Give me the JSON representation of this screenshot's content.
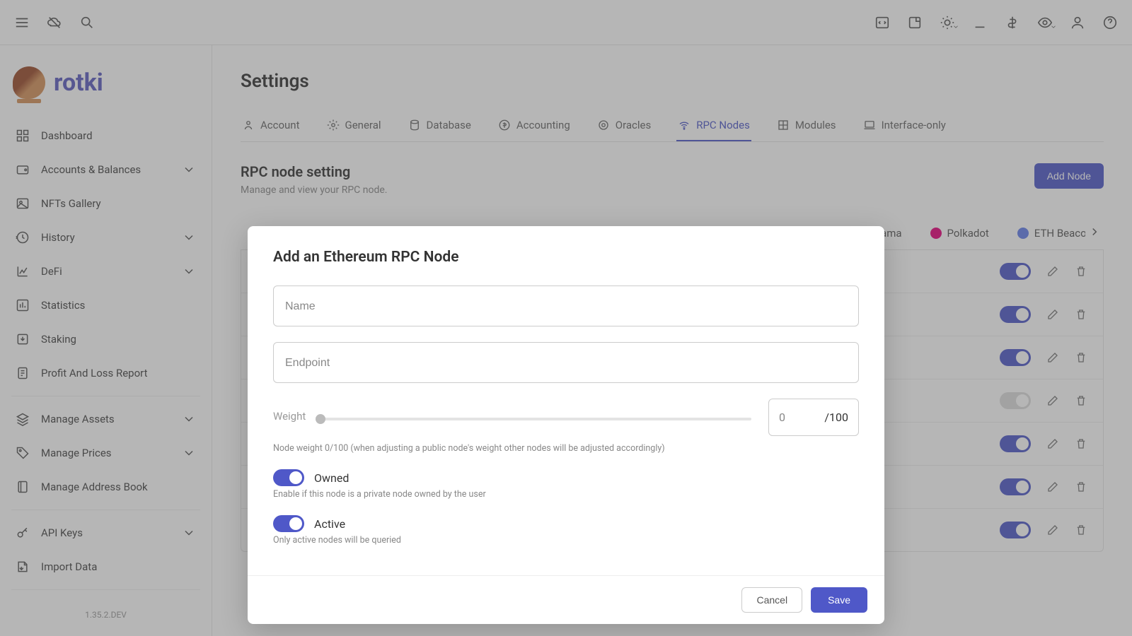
{
  "brand": {
    "name": "rotki"
  },
  "version": "1.35.2.DEV",
  "sidebar": {
    "items": [
      {
        "label": "Dashboard",
        "icon": "dashboard-icon"
      },
      {
        "label": "Accounts & Balances",
        "icon": "wallet-icon",
        "expandable": true
      },
      {
        "label": "NFTs Gallery",
        "icon": "image-icon"
      },
      {
        "label": "History",
        "icon": "history-icon",
        "expandable": true
      },
      {
        "label": "DeFi",
        "icon": "chart-icon",
        "expandable": true
      },
      {
        "label": "Statistics",
        "icon": "stats-icon"
      },
      {
        "label": "Staking",
        "icon": "download-icon"
      },
      {
        "label": "Profit And Loss Report",
        "icon": "report-icon"
      }
    ],
    "manage": [
      {
        "label": "Manage Assets",
        "icon": "layers-icon",
        "expandable": true
      },
      {
        "label": "Manage Prices",
        "icon": "tag-icon",
        "expandable": true
      },
      {
        "label": "Manage Address Book",
        "icon": "book-icon"
      }
    ],
    "bottom": [
      {
        "label": "API Keys",
        "icon": "key-icon",
        "expandable": true
      },
      {
        "label": "Import Data",
        "icon": "import-icon"
      }
    ]
  },
  "page": {
    "title": "Settings",
    "tabs": [
      "Account",
      "General",
      "Database",
      "Accounting",
      "Oracles",
      "RPC Nodes",
      "Modules",
      "Interface-only"
    ],
    "active_tab": "RPC Nodes",
    "section_title": "RPC node setting",
    "section_sub": "Manage and view your RPC node.",
    "add_node_btn": "Add Node"
  },
  "chains": {
    "visible": [
      {
        "label": "sama",
        "color": "#000"
      },
      {
        "label": "Polkadot",
        "color": "#e6007a"
      },
      {
        "label": "ETH Beacon",
        "color": "#7a8aa0"
      }
    ]
  },
  "rows": [
    {
      "active": true
    },
    {
      "active": true
    },
    {
      "active": true
    },
    {
      "active": false
    },
    {
      "active": true
    },
    {
      "active": true
    },
    {
      "active": true
    }
  ],
  "modal": {
    "title": "Add an Ethereum RPC Node",
    "name_placeholder": "Name",
    "endpoint_placeholder": "Endpoint",
    "weight_label": "Weight",
    "weight_value": "0",
    "weight_max": "/100",
    "weight_hint": "Node weight 0/100 (when adjusting a public node's weight other nodes will be adjusted accordingly)",
    "owned_label": "Owned",
    "owned_hint": "Enable if this node is a private node owned by the user",
    "owned_on": true,
    "active_label": "Active",
    "active_hint": "Only active nodes will be queried",
    "active_on": true,
    "cancel": "Cancel",
    "save": "Save"
  }
}
